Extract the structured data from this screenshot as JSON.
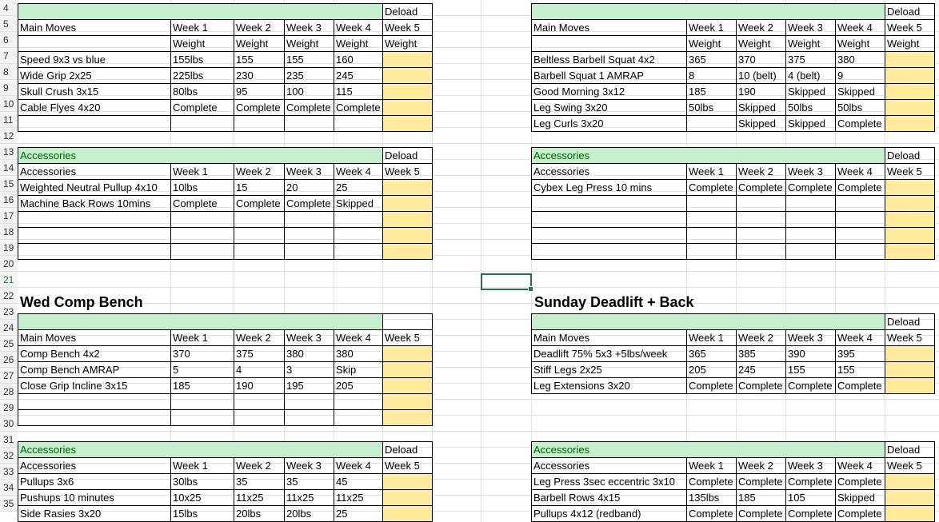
{
  "row_numbers": [
    "4",
    "5",
    "6",
    "7",
    "8",
    "9",
    "10",
    "11",
    "12",
    "13",
    "14",
    "15",
    "16",
    "17",
    "18",
    "19",
    "20",
    "21",
    "22",
    "23",
    "24",
    "25",
    "26",
    "27",
    "28",
    "29",
    "30",
    "31",
    "32",
    "33",
    "34",
    "35"
  ],
  "titles": {
    "wed": "Wed Comp Bench",
    "sun": "Sunday Deadlift + Back"
  },
  "blocks": {
    "tl_main": {
      "header_top": [
        "",
        "",
        "",
        "",
        "",
        "Deload"
      ],
      "rows": [
        [
          "Main Moves",
          "Week 1",
          "Week 2",
          "Week 3",
          "Week 4",
          "Week 5"
        ],
        [
          "",
          "Weight",
          "Weight",
          "Weight",
          "Weight",
          "Weight"
        ],
        [
          "Speed 9x3 vs blue",
          "155lbs",
          "155",
          "155",
          "160",
          ""
        ],
        [
          "Wide Grip 2x25",
          "225lbs",
          "230",
          "235",
          "245",
          ""
        ],
        [
          "Skull Crush 3x15",
          "80lbs",
          "95",
          "100",
          "115",
          ""
        ],
        [
          "Cable Flyes 4x20",
          "Complete",
          "Complete",
          "Complete",
          "Complete",
          ""
        ],
        [
          "",
          "",
          "",
          "",
          "",
          ""
        ]
      ]
    },
    "tl_acc": {
      "header_top": [
        "Accessories",
        "",
        "",
        "",
        "",
        "Deload"
      ],
      "rows": [
        [
          "Accessories",
          "Week 1",
          "Week 2",
          "Week 3",
          "Week 4",
          "Week 5"
        ],
        [
          "Weighted Neutral Pullup 4x10",
          "10lbs",
          "15",
          "20",
          "25",
          ""
        ],
        [
          "Machine Back Rows 10mins",
          "Complete",
          "Complete",
          "Complete",
          "Skipped",
          ""
        ],
        [
          "",
          "",
          "",
          "",
          "",
          ""
        ],
        [
          "",
          "",
          "",
          "",
          "",
          ""
        ],
        [
          "",
          "",
          "",
          "",
          "",
          ""
        ]
      ]
    },
    "tr_main": {
      "header_top": [
        "",
        "",
        "",
        "",
        "",
        "Deload"
      ],
      "rows": [
        [
          "Main Moves",
          "Week 1",
          "Week 2",
          "Week 3",
          "Week 4",
          "Week 5"
        ],
        [
          "",
          "Weight",
          "Weight",
          "Weight",
          "Weight",
          "Weight"
        ],
        [
          "Beltless Barbell Squat 4x2",
          "365",
          "370",
          "375",
          "380",
          ""
        ],
        [
          "Barbell Squat 1 AMRAP",
          "8",
          "10 (belt)",
          "4 (belt)",
          "9",
          ""
        ],
        [
          "Good Morning 3x12",
          "185",
          "190",
          "Skipped",
          "Skipped",
          ""
        ],
        [
          "Leg Swing 3x20",
          "50lbs",
          "Skipped",
          "50lbs",
          "50lbs",
          ""
        ],
        [
          "Leg Curls 3x20",
          "",
          "Skipped",
          "Skipped",
          "Complete",
          ""
        ]
      ]
    },
    "tr_acc": {
      "header_top": [
        "Accessories",
        "",
        "",
        "",
        "",
        "Deload"
      ],
      "rows": [
        [
          "Accessories",
          "Week 1",
          "Week 2",
          "Week 3",
          "Week 4",
          "Week 5"
        ],
        [
          "Cybex Leg Press 10 mins",
          "Complete",
          "Complete",
          "Complete",
          "Complete",
          ""
        ],
        [
          "",
          "",
          "",
          "",
          "",
          ""
        ],
        [
          "",
          "",
          "",
          "",
          "",
          ""
        ],
        [
          "",
          "",
          "",
          "",
          "",
          ""
        ],
        [
          "",
          "",
          "",
          "",
          "",
          ""
        ]
      ]
    },
    "bl_main": {
      "header_top": [
        "",
        "",
        "",
        "",
        "",
        ""
      ],
      "rows": [
        [
          "Main Moves",
          "Week 1",
          "Week 2",
          "Week 3",
          "Week 4",
          "Week 5"
        ],
        [
          "Comp Bench 4x2",
          "370",
          "375",
          "380",
          "380",
          ""
        ],
        [
          "Comp Bench AMRAP",
          "5",
          "4",
          "3",
          "Skip",
          ""
        ],
        [
          "Close Grip Incline 3x15",
          "185",
          "190",
          "195",
          "205",
          ""
        ],
        [
          "",
          "",
          "",
          "",
          "",
          ""
        ],
        [
          "",
          "",
          "",
          "",
          "",
          ""
        ]
      ]
    },
    "bl_acc": {
      "header_top": [
        "Accessories",
        "",
        "",
        "",
        "",
        "Deload"
      ],
      "rows": [
        [
          "Accessories",
          "Week 1",
          "Week 2",
          "Week 3",
          "Week 4",
          "Week 5"
        ],
        [
          "Pullups 3x6",
          "30lbs",
          "35",
          "35",
          "45",
          ""
        ],
        [
          "Pushups 10 minutes",
          "10x25",
          "11x25",
          "11x25",
          "11x25",
          ""
        ],
        [
          "Side Rasies 3x20",
          "15lbs",
          "20lbs",
          "20lbs",
          "25",
          ""
        ]
      ]
    },
    "br_main": {
      "header_top": [
        "",
        "",
        "",
        "",
        "",
        "Deload"
      ],
      "rows": [
        [
          "Main Moves",
          "Week 1",
          "Week 2",
          "Week 3",
          "Week 4",
          "Week 5"
        ],
        [
          "Deadlift 75% 5x3 +5lbs/week",
          "365",
          "385",
          "390",
          "395",
          ""
        ],
        [
          "Stiff Legs 2x25",
          "205",
          "245",
          "155",
          "155",
          ""
        ],
        [
          "Leg Extensions 3x20",
          "Complete",
          "Complete",
          "Complete",
          "Complete",
          ""
        ]
      ]
    },
    "br_acc": {
      "header_top": [
        "Accessories",
        "",
        "",
        "",
        "",
        "Deload"
      ],
      "rows": [
        [
          "Accessories",
          "Week 1",
          "Week 2",
          "Week 3",
          "Week 4",
          "Week 5"
        ],
        [
          "Leg Press 3sec eccentric 3x10",
          "Complete",
          "Complete",
          "Complete",
          "Complete",
          ""
        ],
        [
          "Barbell Rows 4x15",
          "135lbs",
          "185",
          "105",
          "Skipped",
          ""
        ],
        [
          "Pullups 4x12 (redband)",
          "Complete",
          "Complete",
          "Complete",
          "Complete",
          ""
        ]
      ]
    }
  },
  "colors": {
    "header_green": "#c6efce",
    "deload_yellow": "#ffeb9c",
    "selection": "#217346"
  }
}
